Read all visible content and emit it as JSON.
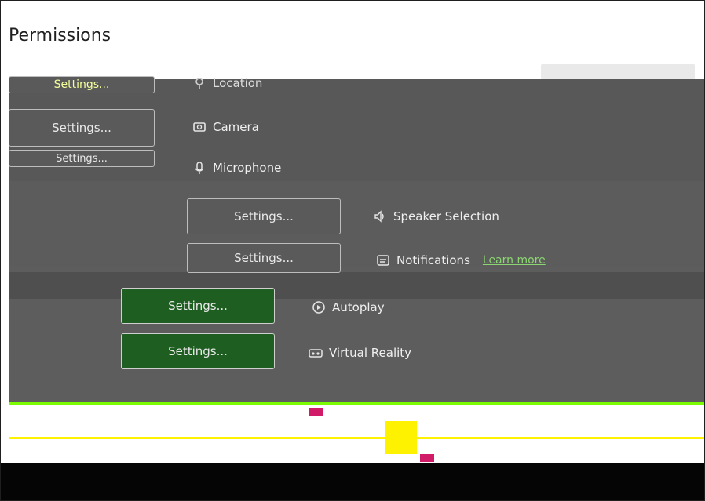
{
  "page": {
    "title": "Permissions"
  },
  "settings_label": "Settings...",
  "learn_more": "Learn more",
  "permissions": [
    {
      "label": "Location",
      "icon": "location-icon"
    },
    {
      "label": "Camera",
      "icon": "camera-icon"
    },
    {
      "label": "Microphone",
      "icon": "microphone-icon"
    },
    {
      "label": "Speaker Selection",
      "icon": "speaker-icon"
    },
    {
      "label": "Notifications",
      "icon": "notifications-icon"
    },
    {
      "label": "Autoplay",
      "icon": "autoplay-icon"
    },
    {
      "label": "Virtual Reality",
      "icon": "virtual-reality-icon"
    }
  ],
  "colors": {
    "panel": "#585858",
    "green_button": "#1e5f21",
    "link": "#8bd672"
  }
}
